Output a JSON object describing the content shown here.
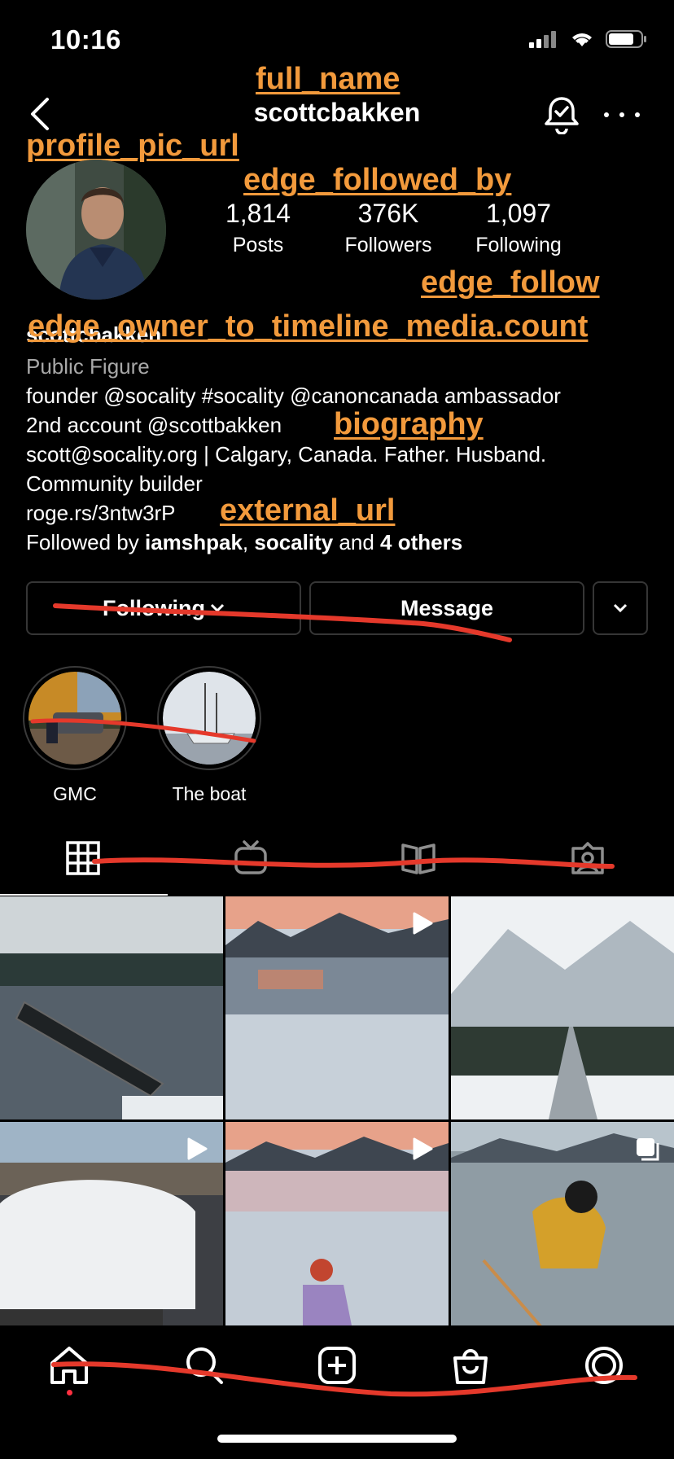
{
  "status_bar": {
    "time": "10:16"
  },
  "annotations": {
    "full_name": "full_name",
    "profile_pic_url": "profile_pic_url",
    "edge_followed_by": "edge_followed_by",
    "edge_follow": "edge_follow",
    "media_count": "edge_owner_to_timeline_media.count",
    "biography": "biography",
    "external_url": "external_url"
  },
  "header": {
    "username": "scottcbakken"
  },
  "stats": [
    {
      "num": "1,814",
      "label": "Posts"
    },
    {
      "num": "376K",
      "label": "Followers"
    },
    {
      "num": "1,097",
      "label": "Following"
    }
  ],
  "profile": {
    "name": "scottcbakken",
    "category": "Public Figure",
    "bio_line1": "founder @socality #socality @canoncanada ambassador",
    "bio_line2": "2nd account @scottbakken",
    "bio_line3": "scott@socality.org | Calgary, Canada. Father. Husband.",
    "bio_line4": "Community builder",
    "link": "roge.rs/3ntw3rP",
    "followed_by_prefix": "Followed by ",
    "followed_by_user1": "iamshpak",
    "followed_by_sep": ", ",
    "followed_by_user2": "socality",
    "followed_by_and": " and ",
    "followed_by_others": "4 others"
  },
  "actions": {
    "following_label": "Following",
    "message_label": "Message"
  },
  "highlights": [
    {
      "label": "GMC"
    },
    {
      "label": "The boat"
    }
  ],
  "colors": {
    "annotation": "#f29a3c",
    "scribble": "#e5392b",
    "background": "#000000"
  },
  "icons": {
    "tabs": [
      "grid-icon",
      "igtv-icon",
      "guides-icon",
      "tagged-icon"
    ],
    "nav": [
      "home-icon",
      "search-icon",
      "new-post-icon",
      "shop-icon",
      "profile-icon"
    ]
  }
}
